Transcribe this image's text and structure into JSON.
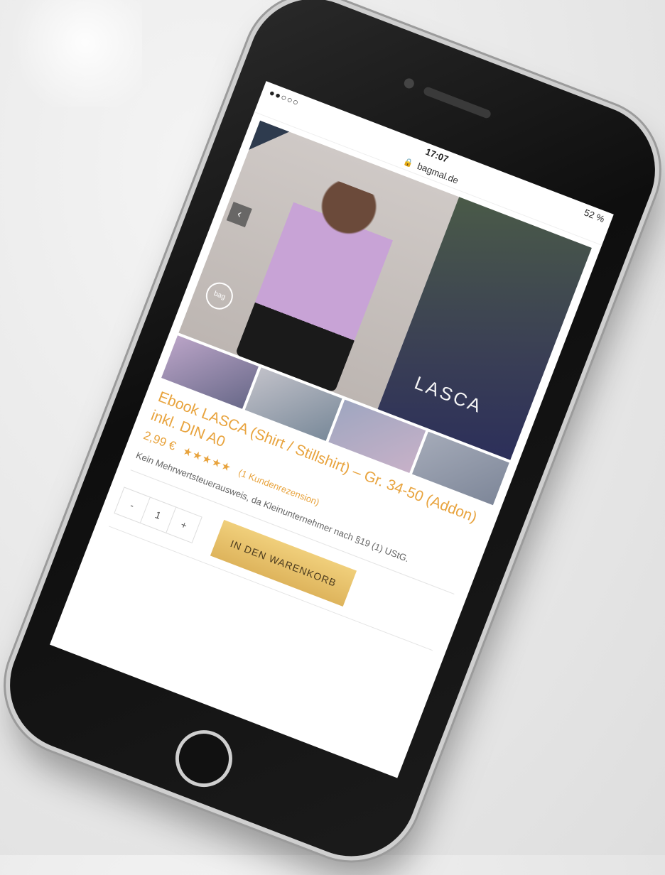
{
  "status_bar": {
    "signal": "●●○○○",
    "time": "17:07",
    "battery": "52 %"
  },
  "url_bar": {
    "lock_icon": "lock-icon",
    "domain": "bagmal.de"
  },
  "gallery": {
    "prev_label": "‹",
    "overlay_text": "LASCA",
    "logo_text": "bag"
  },
  "product": {
    "title": "Ebook LASCA (Shirt / Stillshirt) – Gr. 34-50 (Addon) inkl. DIN A0",
    "price": "2,99 €",
    "stars": "★★★★★",
    "rating": 5,
    "review_link": "(1 Kundenrezension)",
    "tax_note": "Kein Mehrwertsteuerausweis, da Kleinunternehmer nach §19 (1) UStG.",
    "quantity": {
      "minus": "-",
      "value": "1",
      "plus": "+"
    },
    "add_to_cart": "IN DEN WARENKORB"
  },
  "colors": {
    "accent": "#e8a33d",
    "button": "#e3bb61"
  }
}
